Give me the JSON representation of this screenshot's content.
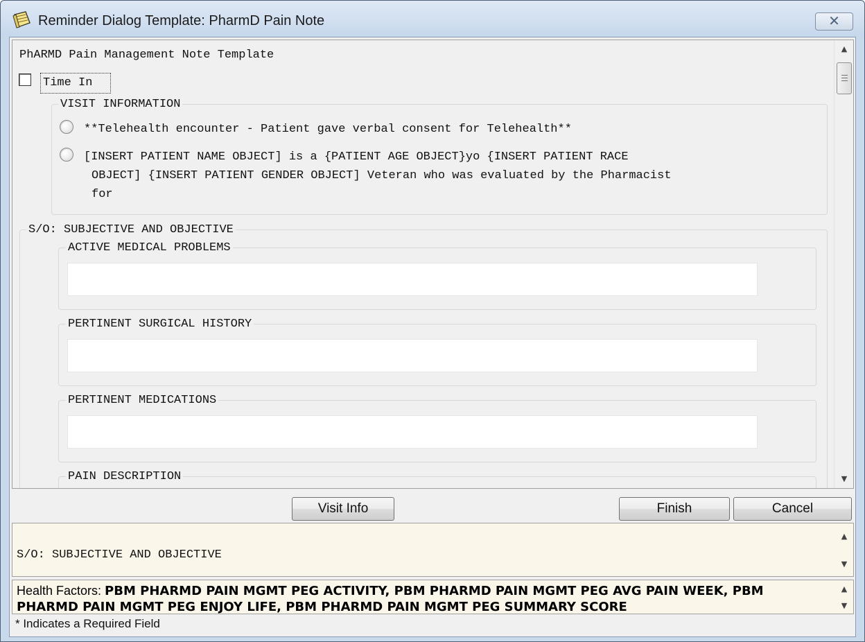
{
  "window": {
    "title": "Reminder Dialog Template: PharmD Pain Note",
    "close_glyph": "✕"
  },
  "template": {
    "header": "PhARMD Pain Management Note Template",
    "time_in_label": "Time In",
    "visit_information": {
      "label": "VISIT INFORMATION",
      "option_1": "**Telehealth encounter - Patient gave verbal consent for Telehealth**",
      "option_2_line_1": "[INSERT PATIENT NAME OBJECT] is a {PATIENT AGE OBJECT}yo {INSERT PATIENT RACE",
      "option_2_line_2": "OBJECT] {INSERT PATIENT GENDER OBJECT] Veteran who was evaluated by the Pharmacist",
      "option_2_line_3": "for"
    },
    "subjective_objective": {
      "label": "S/O: SUBJECTIVE AND OBJECTIVE",
      "active_medical_problems": "ACTIVE MEDICAL PROBLEMS",
      "pertinent_surgical_history": "PERTINENT SURGICAL HISTORY",
      "pertinent_medications": "PERTINENT MEDICATIONS",
      "pain_description": "PAIN DESCRIPTION"
    }
  },
  "buttons": {
    "visit_info": "Visit Info",
    "finish": "Finish",
    "cancel": "Cancel"
  },
  "preview": {
    "text": "S/O: SUBJECTIVE AND OBJECTIVE"
  },
  "health_factors": {
    "label": "Health Factors: ",
    "values": "PBM PHARMD PAIN MGMT PEG ACTIVITY, PBM PHARMD PAIN MGMT PEG AVG PAIN WEEK, PBM PHARMD PAIN MGMT PEG ENJOY LIFE, PBM PHARMD PAIN MGMT PEG SUMMARY SCORE"
  },
  "status": {
    "required_note": "* Indicates a Required Field"
  },
  "icons": {
    "app": "note-pad-icon",
    "scroll_up": "scroll-up-arrow-icon",
    "scroll_down": "scroll-down-arrow-icon"
  },
  "colors": {
    "titlebar": "#c9d9ec",
    "client_bg": "#f0f0f0",
    "preview_bg": "#fbf6ea",
    "memo_bg": "#ffffff"
  }
}
